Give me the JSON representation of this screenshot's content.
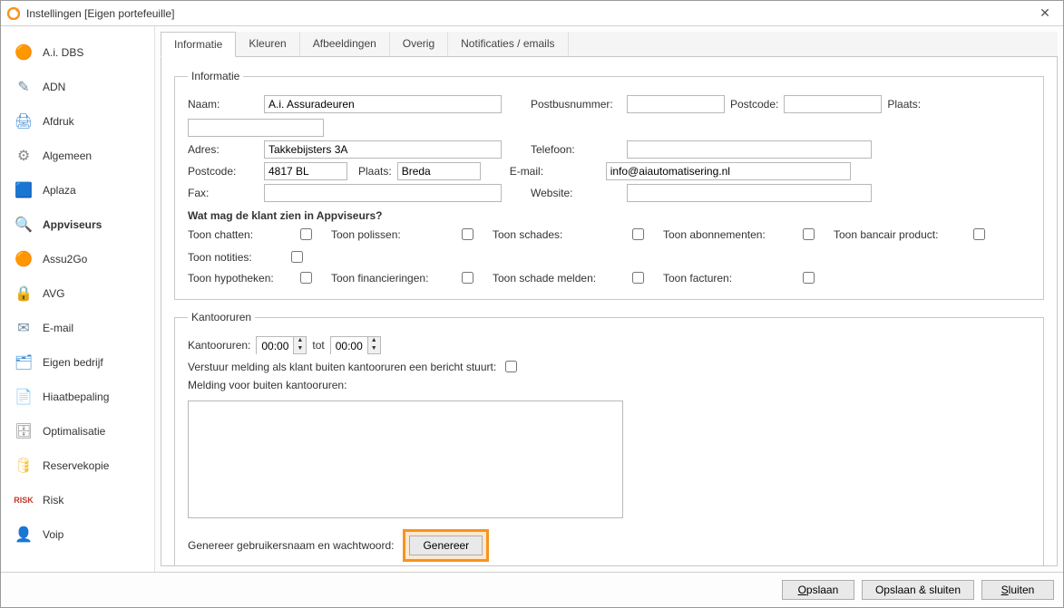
{
  "window": {
    "title": "Instellingen [Eigen portefeuille]"
  },
  "sidebar": {
    "items": [
      {
        "label": "A.i. DBS",
        "icon": "🟠",
        "color": "#f7931e"
      },
      {
        "label": "ADN",
        "icon": "✎",
        "color": "#6b8a9c"
      },
      {
        "label": "Afdruk",
        "icon": "🖨",
        "color": "#3e8bd6"
      },
      {
        "label": "Algemeen",
        "icon": "⚙",
        "color": "#888"
      },
      {
        "label": "Aplaza",
        "icon": "🟦",
        "color": "#2aa9e0"
      },
      {
        "label": "Appviseurs",
        "icon": "🔍",
        "color": "#2aa9e0"
      },
      {
        "label": "Assu2Go",
        "icon": "🟠",
        "color": "#f7931e"
      },
      {
        "label": "AVG",
        "icon": "🔒",
        "color": "#2d5aa0"
      },
      {
        "label": "E-mail",
        "icon": "✉",
        "color": "#6b8a9c"
      },
      {
        "label": "Eigen bedrijf",
        "icon": "🗂",
        "color": "#3e8bd6"
      },
      {
        "label": "Hiaatbepaling",
        "icon": "📄",
        "color": "#888"
      },
      {
        "label": "Optimalisatie",
        "icon": "🗄",
        "color": "#888"
      },
      {
        "label": "Reservekopie",
        "icon": "🛢",
        "color": "#f7c142"
      },
      {
        "label": "Risk",
        "icon": "RISK",
        "color": "#c0392b"
      },
      {
        "label": "Voip",
        "icon": "👤",
        "color": "#3e8bd6"
      }
    ],
    "active_index": 5
  },
  "tabs": {
    "items": [
      "Informatie",
      "Kleuren",
      "Afbeeldingen",
      "Overig",
      "Notificaties / emails"
    ],
    "active_index": 0
  },
  "info": {
    "legend": "Informatie",
    "labels": {
      "naam": "Naam:",
      "adres": "Adres:",
      "postcode": "Postcode:",
      "plaats": "Plaats:",
      "fax": "Fax:",
      "postbusnummer": "Postbusnummer:",
      "postcode2": "Postcode:",
      "plaats2": "Plaats:",
      "telefoon": "Telefoon:",
      "email": "E-mail:",
      "website": "Website:"
    },
    "values": {
      "naam": "A.i. Assuradeuren",
      "adres": "Takkebijsters 3A",
      "postcode": "4817 BL",
      "plaats": "Breda",
      "fax": "",
      "postbusnummer": "",
      "postcode2": "",
      "plaats2": "",
      "telefoon": "",
      "email": "info@aiautomatisering.nl",
      "website": ""
    },
    "permissions_title": "Wat mag de klant zien in Appviseurs?",
    "permissions": [
      {
        "label": "Toon chatten:",
        "checked": false
      },
      {
        "label": "Toon polissen:",
        "checked": false
      },
      {
        "label": "Toon schades:",
        "checked": false
      },
      {
        "label": "Toon abonnementen:",
        "checked": false
      },
      {
        "label": "Toon bancair product:",
        "checked": false
      },
      {
        "label": "Toon notities:",
        "checked": false
      },
      {
        "label": "Toon hypotheken:",
        "checked": false
      },
      {
        "label": "Toon financieringen:",
        "checked": false
      },
      {
        "label": "Toon schade melden:",
        "checked": false
      },
      {
        "label": "Toon facturen:",
        "checked": false
      }
    ]
  },
  "hours": {
    "legend": "Kantooruren",
    "labels": {
      "kantooruren": "Kantooruren:",
      "tot": "tot",
      "melding_check": "Verstuur melding als klant buiten kantooruren een bericht stuurt:",
      "melding_text": "Melding voor buiten kantooruren:"
    },
    "values": {
      "from": "00:00",
      "to": "00:00",
      "send": false,
      "message": ""
    }
  },
  "generate": {
    "label": "Genereer gebruikersnaam en wachtwoord:",
    "button": "Genereer"
  },
  "footer": {
    "save": "Opslaan",
    "save_close": "Opslaan & sluiten",
    "close": "Sluiten"
  }
}
